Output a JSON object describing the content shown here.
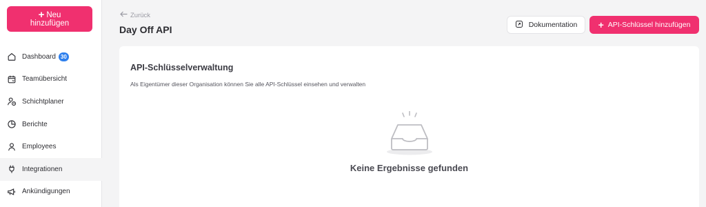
{
  "sidebar": {
    "new_button": {
      "line1": "Neu",
      "line2": "hinzufügen"
    },
    "items": [
      {
        "label": "Dashboard",
        "icon": "home-icon",
        "badge": "30"
      },
      {
        "label": "Teamübersicht",
        "icon": "calendar-icon"
      },
      {
        "label": "Schichtplaner",
        "icon": "user-clock-icon"
      },
      {
        "label": "Berichte",
        "icon": "pie-chart-icon"
      },
      {
        "label": "Employees",
        "icon": "user-icon"
      },
      {
        "label": "Integrationen",
        "icon": "plug-icon",
        "active": true
      },
      {
        "label": "Ankündigungen",
        "icon": "megaphone-icon"
      }
    ]
  },
  "header": {
    "back_label": "Zurück",
    "title": "Day Off API",
    "doc_button": "Dokumentation",
    "add_button": "API-Schlüssel hinzufügen"
  },
  "main": {
    "title": "API-Schlüsselverwaltung",
    "subtitle": "Als Eigentümer dieser Organisation können Sie alle API-Schlüssel einsehen und verwalten",
    "empty_text": "Keine Ergebnisse gefunden"
  },
  "colors": {
    "accent": "#f0306f",
    "badge": "#2f80ed",
    "background": "#f4f4f5"
  }
}
